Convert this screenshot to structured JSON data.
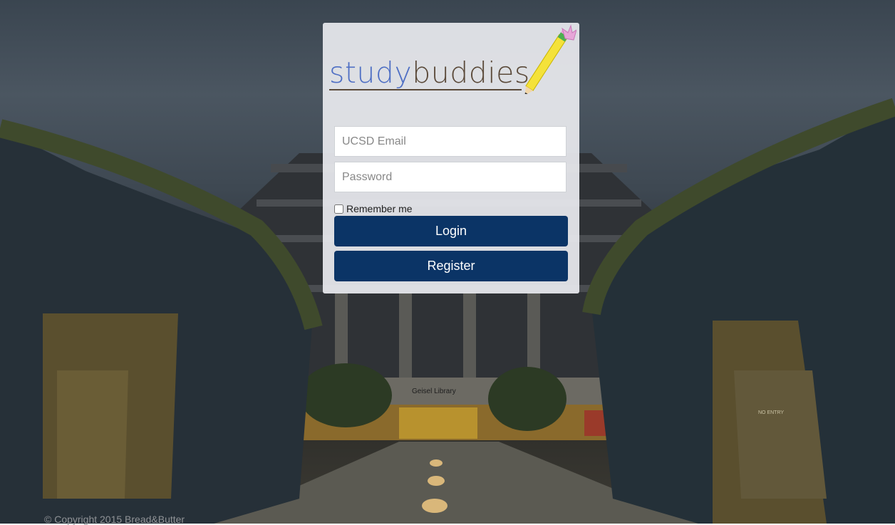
{
  "logo": {
    "study": "study",
    "buddies": "buddies",
    "study_color": "#4f6fc4",
    "buddies_color": "#5b4a3a",
    "icon": "pencil-icon"
  },
  "form": {
    "email_placeholder": "UCSD Email",
    "password_placeholder": "Password",
    "remember_label": "Remember me",
    "login_label": "Login",
    "register_label": "Register",
    "button_color": "#0b3466"
  },
  "background": {
    "building_sign": "Geisel Library",
    "door_sign": "NO ENTRY"
  },
  "footer": {
    "copyright": "© Copyright 2015 Bread&Butter"
  }
}
